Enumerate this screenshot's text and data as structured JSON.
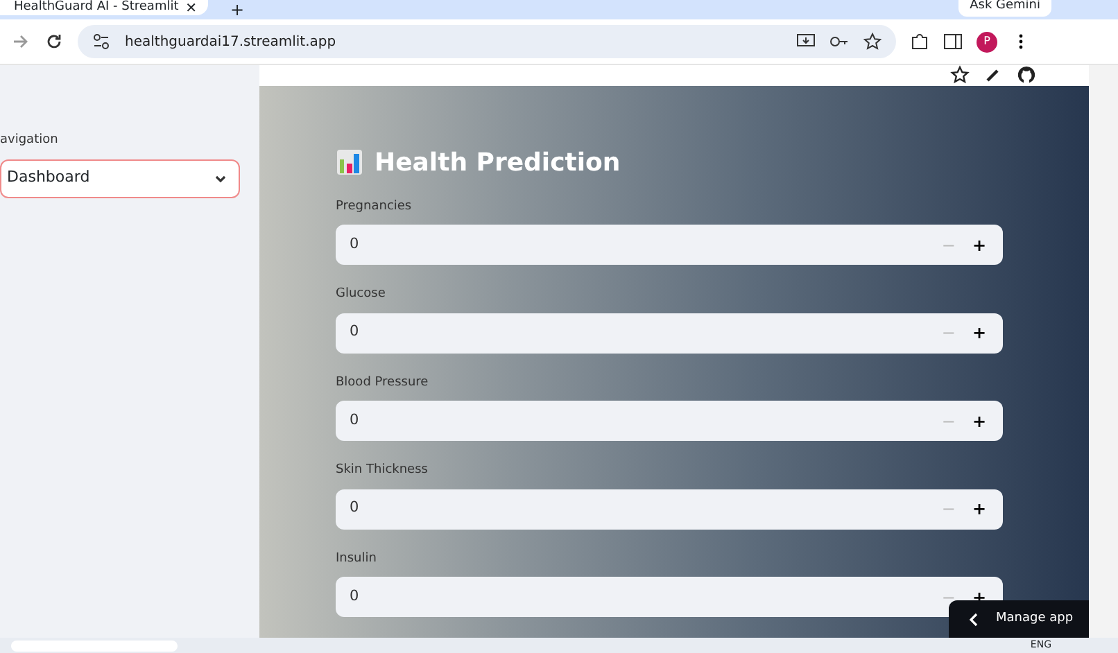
{
  "browser": {
    "tab_title": "HealthGuard AI - Streamlit",
    "close": "✕",
    "new_tab": "+",
    "ask_button": "Ask Gemini",
    "url": "healthguardai17.streamlit.app",
    "profile": "P"
  },
  "sidebar": {
    "label": "avigation",
    "select_value": "Dashboard"
  },
  "main": {
    "title": "Health Prediction",
    "fields": [
      {
        "label": "Pregnancies",
        "value": "0",
        "minus": "−",
        "plus": "+",
        "minus_disabled": true
      },
      {
        "label": "Glucose",
        "value": "0",
        "minus": "−",
        "plus": "+",
        "minus_disabled": true
      },
      {
        "label": "Blood Pressure",
        "value": "0",
        "minus": "−",
        "plus": "+",
        "minus_disabled": true
      },
      {
        "label": "Skin Thickness",
        "value": "0",
        "minus": "−",
        "plus": "+",
        "minus_disabled": true
      },
      {
        "label": "Insulin",
        "value": "0",
        "minus": "−",
        "plus": "+",
        "minus_disabled": true
      }
    ]
  },
  "manage_app": "Manage app",
  "taskbar": {
    "language": "ENG"
  }
}
